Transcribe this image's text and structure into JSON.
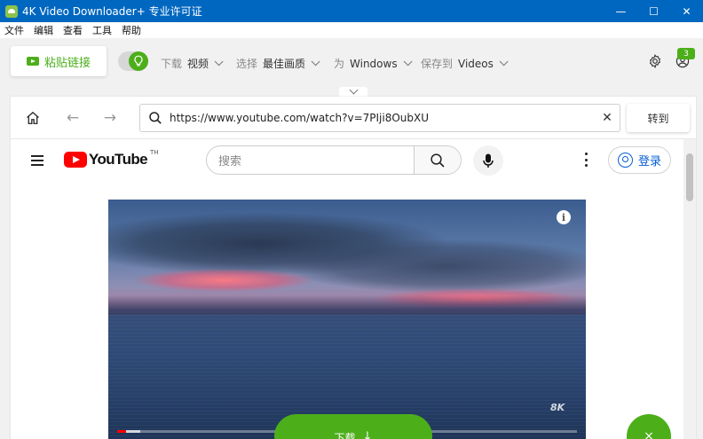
{
  "window": {
    "title": "4K Video Downloader+ 专业许可证",
    "minimize_glyph": "—",
    "maximize_glyph": "☐",
    "close_glyph": "✕"
  },
  "menubar": {
    "items": [
      "文件",
      "编辑",
      "查看",
      "工具",
      "帮助"
    ]
  },
  "toolbar": {
    "paste_label": "粘贴链接",
    "download_prefix": "下载",
    "download_value": "视频",
    "select_prefix": "选择",
    "select_value": "最佳画质",
    "for_prefix": "为",
    "for_value": "Windows",
    "save_prefix": "保存到",
    "save_value": "Videos",
    "notification_count": "3",
    "smart_mode_on": true,
    "accent_color": "#4caf1a"
  },
  "browser": {
    "url": "https://www.youtube.com/watch?v=7PIji8OubXU",
    "go_label": "转到",
    "clear_glyph": "✕",
    "back_glyph": "←",
    "forward_glyph": "→"
  },
  "youtube": {
    "logo_text": "YouTube",
    "region": "TH",
    "search_placeholder": "搜索",
    "signin_label": "登录",
    "info_glyph": "i",
    "watermark": "8K",
    "progress_played": 0.02,
    "progress_buffered": 0.05,
    "brand_color": "#ff0000"
  },
  "actions": {
    "download_label": "下载",
    "download_glyph": "↓",
    "fab_glyph": "×"
  }
}
